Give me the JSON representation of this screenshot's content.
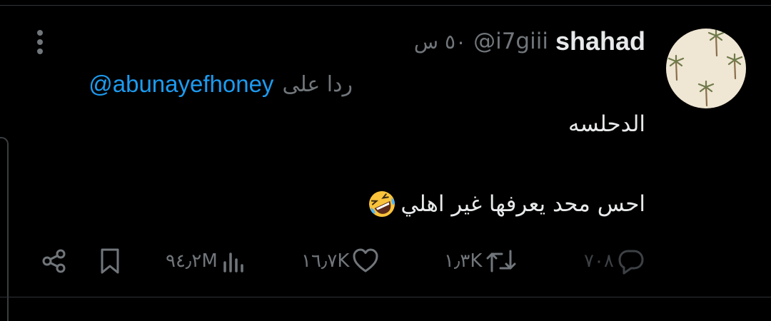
{
  "tweet": {
    "display_name": "shahad",
    "handle": "@i7giii",
    "time": "٥٠ س",
    "reply_prefix": "ردا على",
    "reply_to": "@abunayefhoney",
    "text_line1": "الدحلسه",
    "text_line2": "احس محد يعرفها غير اهلي",
    "emoji_icon": "rolling-on-floor-laughing-icon"
  },
  "actions": {
    "replies": "٧٠٨",
    "retweets": "١٫٣K",
    "likes": "١٦٫٧K",
    "views": "٩٤٫٢M"
  },
  "colors": {
    "background": "#000000",
    "text": "#e7e9ea",
    "secondary": "#71767b",
    "link": "#1d9bf0",
    "avatar_bg": "#efe6d3"
  }
}
